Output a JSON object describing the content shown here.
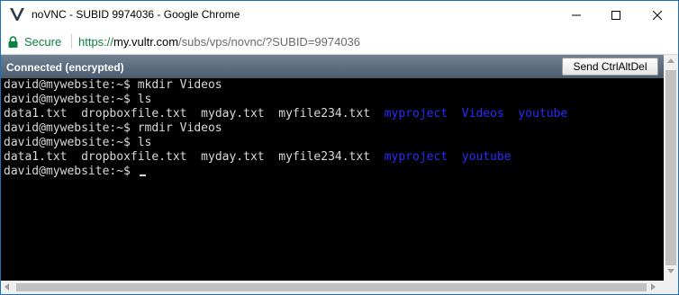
{
  "window": {
    "title": "noVNC - SUBID 9974036 - Google Chrome",
    "app_icon": "novnc-logo"
  },
  "address_bar": {
    "security_label": "Secure",
    "url_scheme": "https://",
    "url_host": "my.vultr.com",
    "url_rest": "/subs/vps/novnc/?SUBID=9974036"
  },
  "vnc": {
    "status": "Connected (encrypted)",
    "ctrl_alt_del_label": "Send CtrlAltDel"
  },
  "terminal": {
    "lines": [
      {
        "text": "david@mywebsite:~$ mkdir Videos"
      },
      {
        "text": "david@mywebsite:~$ ls"
      },
      {
        "files": [
          "data1.txt",
          "dropboxfile.txt",
          "myday.txt",
          "myfile234.txt"
        ],
        "dirs": [
          "myproject",
          "Videos",
          "youtube"
        ]
      },
      {
        "text": "david@mywebsite:~$ rmdir Videos"
      },
      {
        "text": "david@mywebsite:~$ ls"
      },
      {
        "files": [
          "data1.txt",
          "dropboxfile.txt",
          "myday.txt",
          "myfile234.txt"
        ],
        "dirs": [
          "myproject",
          "youtube"
        ]
      },
      {
        "text": "david@mywebsite:~$ "
      }
    ],
    "text_color": "#d8d8d8",
    "directory_color": "#2b2bff",
    "background_color": "#000000"
  }
}
